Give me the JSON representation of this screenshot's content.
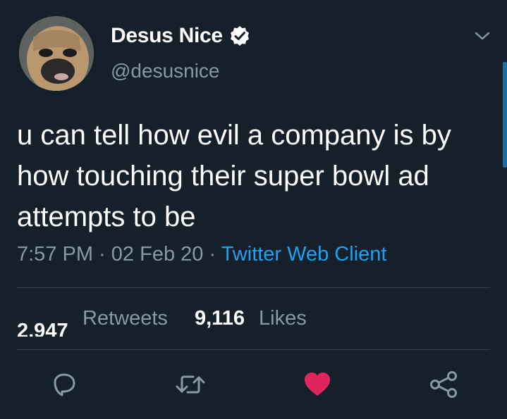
{
  "author": {
    "display_name": "Desus Nice",
    "handle": "@desusnice",
    "verified": true
  },
  "tweet": {
    "text": "u can tell how evil a company is by how touching their super bowl ad attempts to be",
    "time": "7:57 PM",
    "separator": "·",
    "date": "02 Feb 20",
    "client": "Twitter Web Client"
  },
  "stats": {
    "retweets_count": "2,947",
    "retweets_label": "Retweets",
    "likes_count": "9,116",
    "likes_label": "Likes"
  },
  "icons": {
    "reply": "reply-icon",
    "retweet": "retweet-icon",
    "like": "heart-icon",
    "share": "share-icon",
    "more": "chevron-down-icon",
    "verified": "verified-badge-icon"
  },
  "colors": {
    "background": "#15202b",
    "accent": "#1da1f2",
    "like": "#e0245e",
    "secondary_text": "#8899a6"
  }
}
